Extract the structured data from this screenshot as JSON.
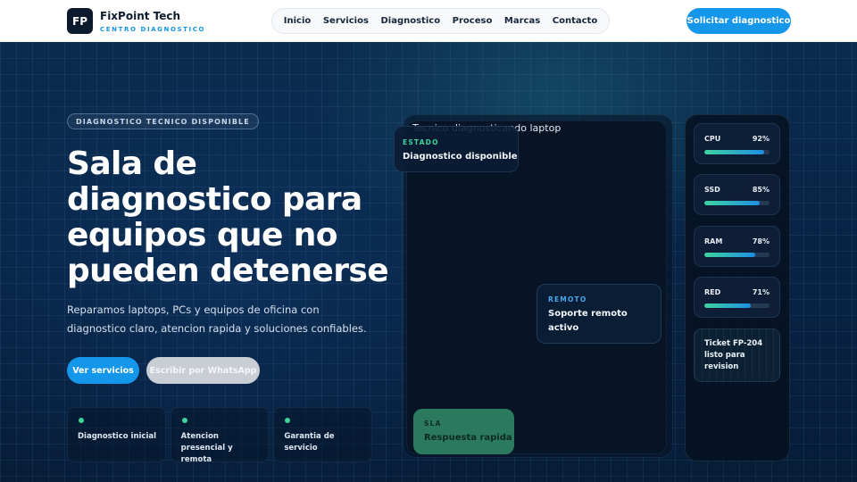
{
  "brand": {
    "logo": "FP",
    "name": "FixPoint Tech",
    "tagline": "CENTRO DIAGNOSTICO"
  },
  "nav": {
    "items": [
      "Inicio",
      "Servicios",
      "Diagnostico",
      "Proceso",
      "Marcas",
      "Contacto"
    ]
  },
  "header_cta": "Solicitar diagnostico",
  "hero": {
    "badge": "DIAGNOSTICO TECNICO DISPONIBLE",
    "title": "Sala de diagnostico para equipos que no pueden detenerse",
    "description": "Reparamos laptops, PCs y equipos de oficina con diagnostico claro, atencion rapida y soluciones confiables.",
    "primary_button": "Ver servicios",
    "secondary_button": "Escribir por WhatsApp",
    "features": [
      "Diagnostico inicial",
      "Atencion presencial y remota",
      "Garantia de servicio"
    ]
  },
  "device": {
    "image_alt": "Tecnico diagnosticando laptop",
    "estado": {
      "label": "ESTADO",
      "value": "Diagnostico disponible"
    },
    "remoto": {
      "label": "REMOTO",
      "value": "Soporte remoto activo"
    },
    "sla": {
      "label": "SLA",
      "value": "Respuesta rapida"
    }
  },
  "metrics": [
    {
      "name": "CPU",
      "value": "92%",
      "level": 0.92
    },
    {
      "name": "SSD",
      "value": "85%",
      "level": 0.85
    },
    {
      "name": "RAM",
      "value": "78%",
      "level": 0.78
    },
    {
      "name": "RED",
      "value": "71%",
      "level": 0.71
    }
  ],
  "ticket": "Ticket FP-204 listo para revision",
  "colors": {
    "accent": "#1497ea",
    "success": "#3fd39a",
    "dark": "#0c1a2e",
    "sla": "#2b7a60"
  }
}
